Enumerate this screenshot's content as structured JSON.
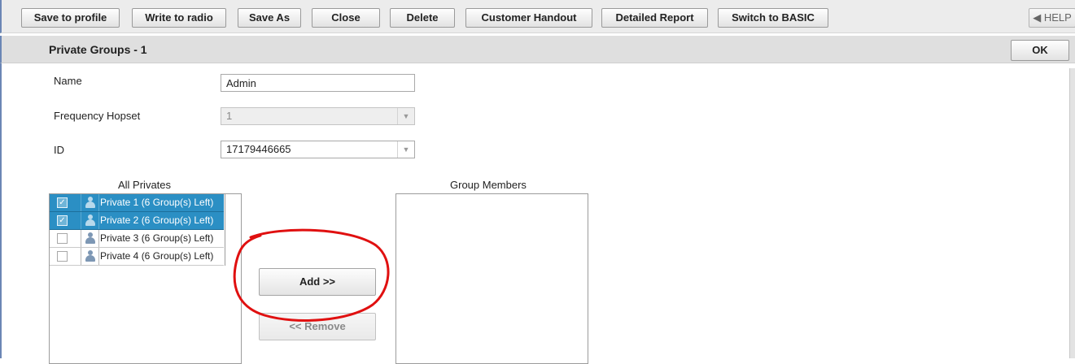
{
  "toolbar": {
    "buttons": [
      "Save to profile",
      "Write to radio",
      "Save As",
      "Close",
      "Delete",
      "Customer Handout",
      "Detailed Report",
      "Switch to BASIC"
    ],
    "help_label": "◀ HELP"
  },
  "title_bar": {
    "title": "Private Groups - 1",
    "ok_label": "OK"
  },
  "form": {
    "name_label": "Name",
    "name_value": "Admin",
    "hopset_label": "Frequency Hopset",
    "hopset_value": "1",
    "id_label": "ID",
    "id_value": "17179446665"
  },
  "all_privates": {
    "header": "All Privates",
    "rows": [
      {
        "label": "Private 1 (6 Group(s) Left)",
        "checked": true,
        "selected": true
      },
      {
        "label": "Private 2 (6 Group(s) Left)",
        "checked": true,
        "selected": true
      },
      {
        "label": "Private 3 (6 Group(s) Left)",
        "checked": false,
        "selected": false
      },
      {
        "label": "Private 4 (6 Group(s) Left)",
        "checked": false,
        "selected": false
      }
    ]
  },
  "group_members": {
    "header": "Group Members",
    "rows": []
  },
  "actions": {
    "add_label": "Add >>",
    "remove_label": "<< Remove"
  },
  "annotation_color": "#e01010",
  "colors": {
    "selection": "#2b8fc4",
    "frame_border": "#6b86b5"
  }
}
